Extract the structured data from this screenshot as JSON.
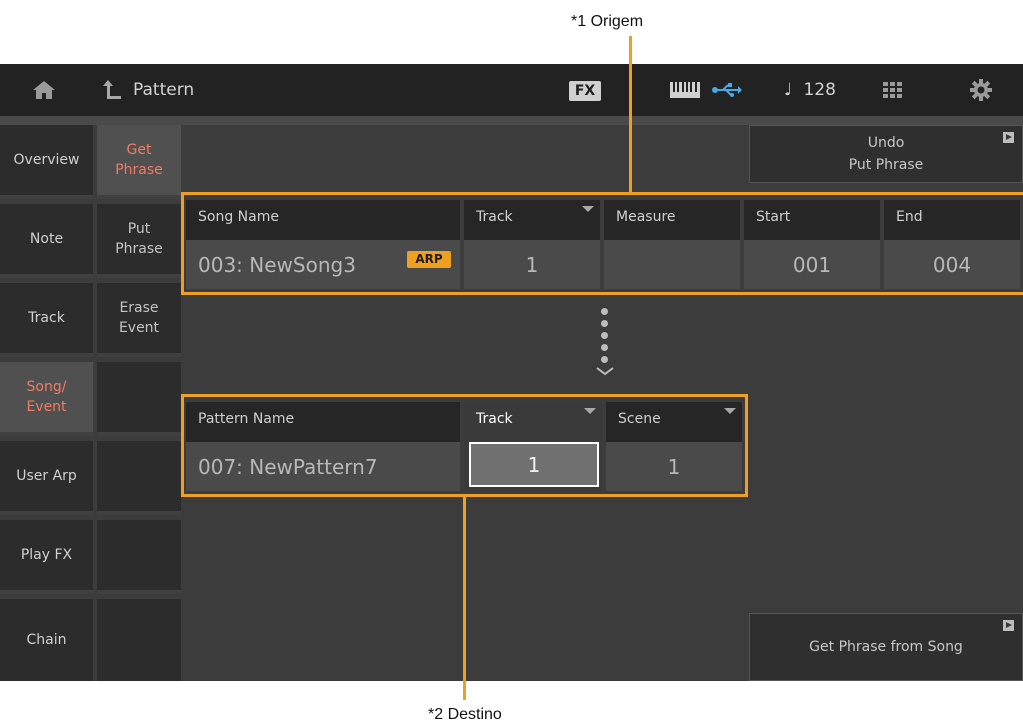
{
  "annotations": {
    "origin": "*1 Origem",
    "destination": "*2 Destino"
  },
  "topbar": {
    "home_icon": "home-icon",
    "back_icon": "back-arrow-icon",
    "title": "Pattern",
    "fx_label": "FX",
    "keyboard_icon": "keyboard-icon",
    "usb_icon": "usb-icon",
    "tempo_symbol": "♩",
    "tempo_value": "128",
    "grid_icon": "grid-icon",
    "settings_icon": "gear-icon"
  },
  "sidebar": {
    "items": [
      {
        "label": "Overview",
        "active": false
      },
      {
        "label": "Note",
        "active": false
      },
      {
        "label": "Track",
        "active": false
      },
      {
        "label": "Song/\nEvent",
        "active": true
      },
      {
        "label": "User Arp",
        "active": false
      },
      {
        "label": "Play FX",
        "active": false
      },
      {
        "label": "Chain",
        "active": false
      }
    ]
  },
  "subtabs": {
    "items": [
      {
        "label": "Get\nPhrase",
        "active": true
      },
      {
        "label": "Put\nPhrase",
        "active": false
      },
      {
        "label": "Erase\nEvent",
        "active": false
      }
    ]
  },
  "buttons": {
    "undo": "Undo\nPut Phrase",
    "get_phrase": "Get Phrase from Song"
  },
  "source": {
    "song_name_label": "Song Name",
    "song_name_value": "003: NewSong3",
    "arp_badge": "ARP",
    "track_label": "Track",
    "track_value": "1",
    "measure_label": "Measure",
    "start_label": "Start",
    "start_value": "001",
    "end_label": "End",
    "end_value": "004"
  },
  "destination": {
    "pattern_name_label": "Pattern Name",
    "pattern_name_value": "007: NewPattern7",
    "track_label": "Track",
    "track_value": "1",
    "scene_label": "Scene",
    "scene_value": "1"
  },
  "colors": {
    "highlight": "#f0a020",
    "active_text": "#f07c62",
    "usb": "#4aa8e8"
  }
}
